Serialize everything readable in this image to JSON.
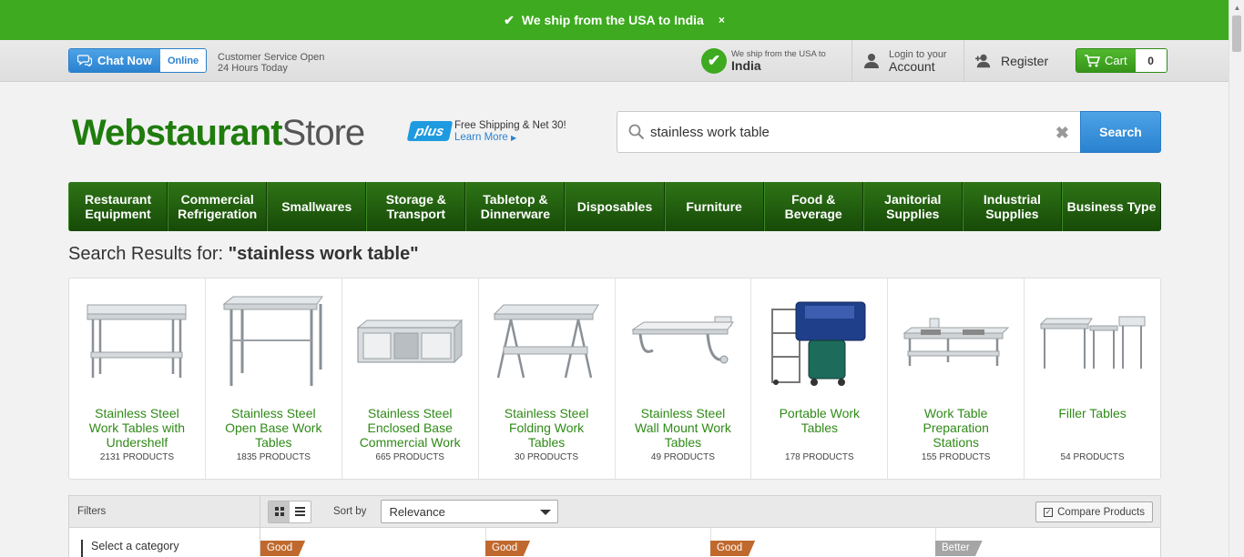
{
  "banner": {
    "text": "We ship from the USA to India",
    "close": "×"
  },
  "util": {
    "chat_label": "Chat Now",
    "chat_status": "Online",
    "cs_line1": "Customer Service Open",
    "cs_line2": "24 Hours Today",
    "ship_small": "We ship from the USA to",
    "ship_country": "India",
    "account_small": "Login to your",
    "account_big": "Account",
    "register": "Register",
    "cart_label": "Cart",
    "cart_count": "0"
  },
  "header": {
    "logo_a": "Webstaurant",
    "logo_b": "Store",
    "plus": "plus",
    "plus_line1": "Free Shipping & Net 30!",
    "plus_line2": "Learn More",
    "search_value": "stainless work table",
    "search_button": "Search"
  },
  "nav": [
    "Restaurant Equipment",
    "Commercial Refrigeration",
    "Smallwares",
    "Storage & Transport",
    "Tabletop & Dinnerware",
    "Disposables",
    "Furniture",
    "Food & Beverage",
    "Janitorial Supplies",
    "Industrial Supplies",
    "Business Type"
  ],
  "results": {
    "prefix": "Search Results for: ",
    "query": "\"stainless work table\""
  },
  "categories": [
    {
      "name": "Stainless Steel Work Tables with Undershelf",
      "count": "2131 PRODUCTS"
    },
    {
      "name": "Stainless Steel Open Base Work Tables",
      "count": "1835 PRODUCTS"
    },
    {
      "name": "Stainless Steel Enclosed Base Commercial Work",
      "count": "665 PRODUCTS"
    },
    {
      "name": "Stainless Steel Folding Work Tables",
      "count": "30 PRODUCTS"
    },
    {
      "name": "Stainless Steel Wall Mount Work Tables",
      "count": "49 PRODUCTS"
    },
    {
      "name": "Portable Work Tables",
      "count": "178 PRODUCTS"
    },
    {
      "name": "Work Table Preparation Stations",
      "count": "155 PRODUCTS"
    },
    {
      "name": "Filler Tables",
      "count": "54 PRODUCTS"
    }
  ],
  "toolbar": {
    "filters": "Filters",
    "sort_by": "Sort by",
    "sort_value": "Relevance",
    "compare": "Compare Products"
  },
  "sidebar": {
    "select_category": "Select a category"
  },
  "tags": [
    "Good",
    "Good",
    "Good",
    "Better"
  ],
  "colors": {
    "brand_green": "#3eaa1f",
    "nav_green": "#1f5f0f",
    "link_green": "#2f8a17",
    "accent_blue": "#2a82d0"
  }
}
